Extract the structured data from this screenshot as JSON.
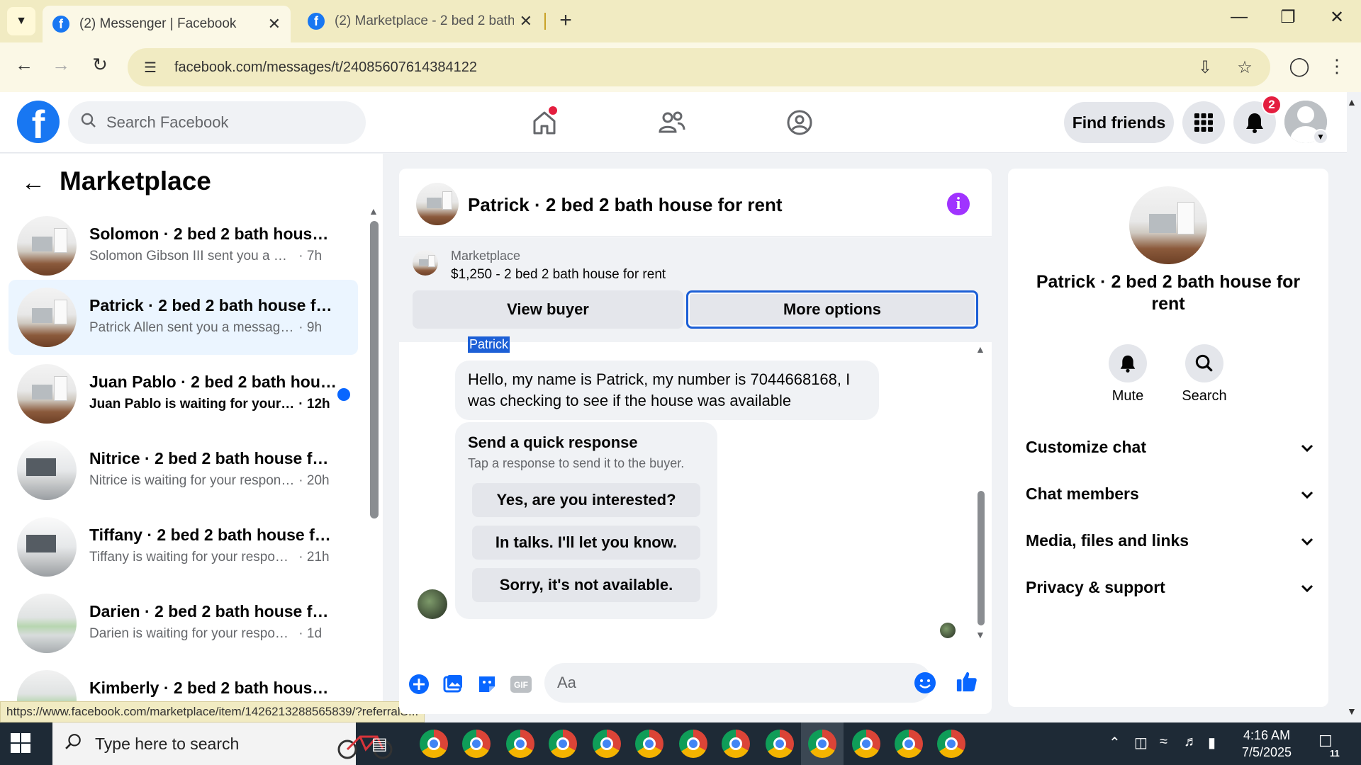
{
  "browser": {
    "tabs": [
      {
        "title": "(2) Messenger | Facebook",
        "active": true
      },
      {
        "title": "(2) Marketplace - 2 bed 2 bath house for rent",
        "active": false
      }
    ],
    "url": "facebook.com/messages/t/24085607614384122",
    "status_url": "https://www.facebook.com/marketplace/item/1426213288565839/?referralS..."
  },
  "fb_header": {
    "logo": "f",
    "search_placeholder": "Search Facebook",
    "find_friends_label": "Find friends",
    "notification_count": "2"
  },
  "left_panel": {
    "title": "Marketplace",
    "conversations": [
      {
        "name": "Solomon · 2 bed 2 bath house for rent",
        "preview": "Solomon Gibson III sent you a mes...",
        "time": "7h",
        "selected": false,
        "unread": false
      },
      {
        "name": "Patrick · 2 bed 2 bath house for rent",
        "preview": "Patrick Allen sent you a message a...",
        "time": "9h",
        "selected": true,
        "unread": false
      },
      {
        "name": "Juan Pablo · 2 bed 2 bath house for rent",
        "preview": "Juan Pablo is waiting for your ...",
        "time": "12h",
        "selected": false,
        "unread": true
      },
      {
        "name": "Nitrice · 2 bed 2 bath house for rent",
        "preview": "Nitrice is waiting for your response.",
        "time": "20h",
        "selected": false,
        "unread": false
      },
      {
        "name": "Tiffany · 2 bed 2 bath house for rent",
        "preview": "Tiffany is waiting for your response.",
        "time": "21h",
        "selected": false,
        "unread": false
      },
      {
        "name": "Darien · 2 bed 2 bath house for rent",
        "preview": "Darien is waiting for your response.",
        "time": "1d",
        "selected": false,
        "unread": false
      },
      {
        "name": "Kimberly · 2 bed 2 bath house for rent",
        "preview": "",
        "time": "",
        "selected": false,
        "unread": false
      }
    ]
  },
  "chat": {
    "title": "Patrick · 2 bed 2 bath house for rent",
    "listing_label": "Marketplace",
    "listing_price": "$1,250 - 2 bed 2 bath house for rent",
    "view_buyer_label": "View buyer",
    "more_options_label": "More options",
    "sender_name": "Patrick",
    "message_line1": "Hello, my name is Patrick, my number is 7044668168, I",
    "message_line2": "was checking to see if the house was available",
    "quick_response_title": "Send a quick response",
    "quick_response_subtitle": "Tap a response to send it to the buyer.",
    "quick_responses": [
      "Yes, are you interested?",
      "In talks. I'll let you know.",
      "Sorry, it's not available."
    ],
    "composer_placeholder": "Aa"
  },
  "right_panel": {
    "title": "Patrick · 2 bed 2 bath house for rent",
    "mute_label": "Mute",
    "search_label": "Search",
    "sections": [
      "Customize chat",
      "Chat members",
      "Media, files and links",
      "Privacy & support"
    ]
  },
  "taskbar": {
    "search_placeholder": "Type here to search",
    "time": "4:16 AM",
    "date": "7/5/2025",
    "notification_count": "11"
  }
}
